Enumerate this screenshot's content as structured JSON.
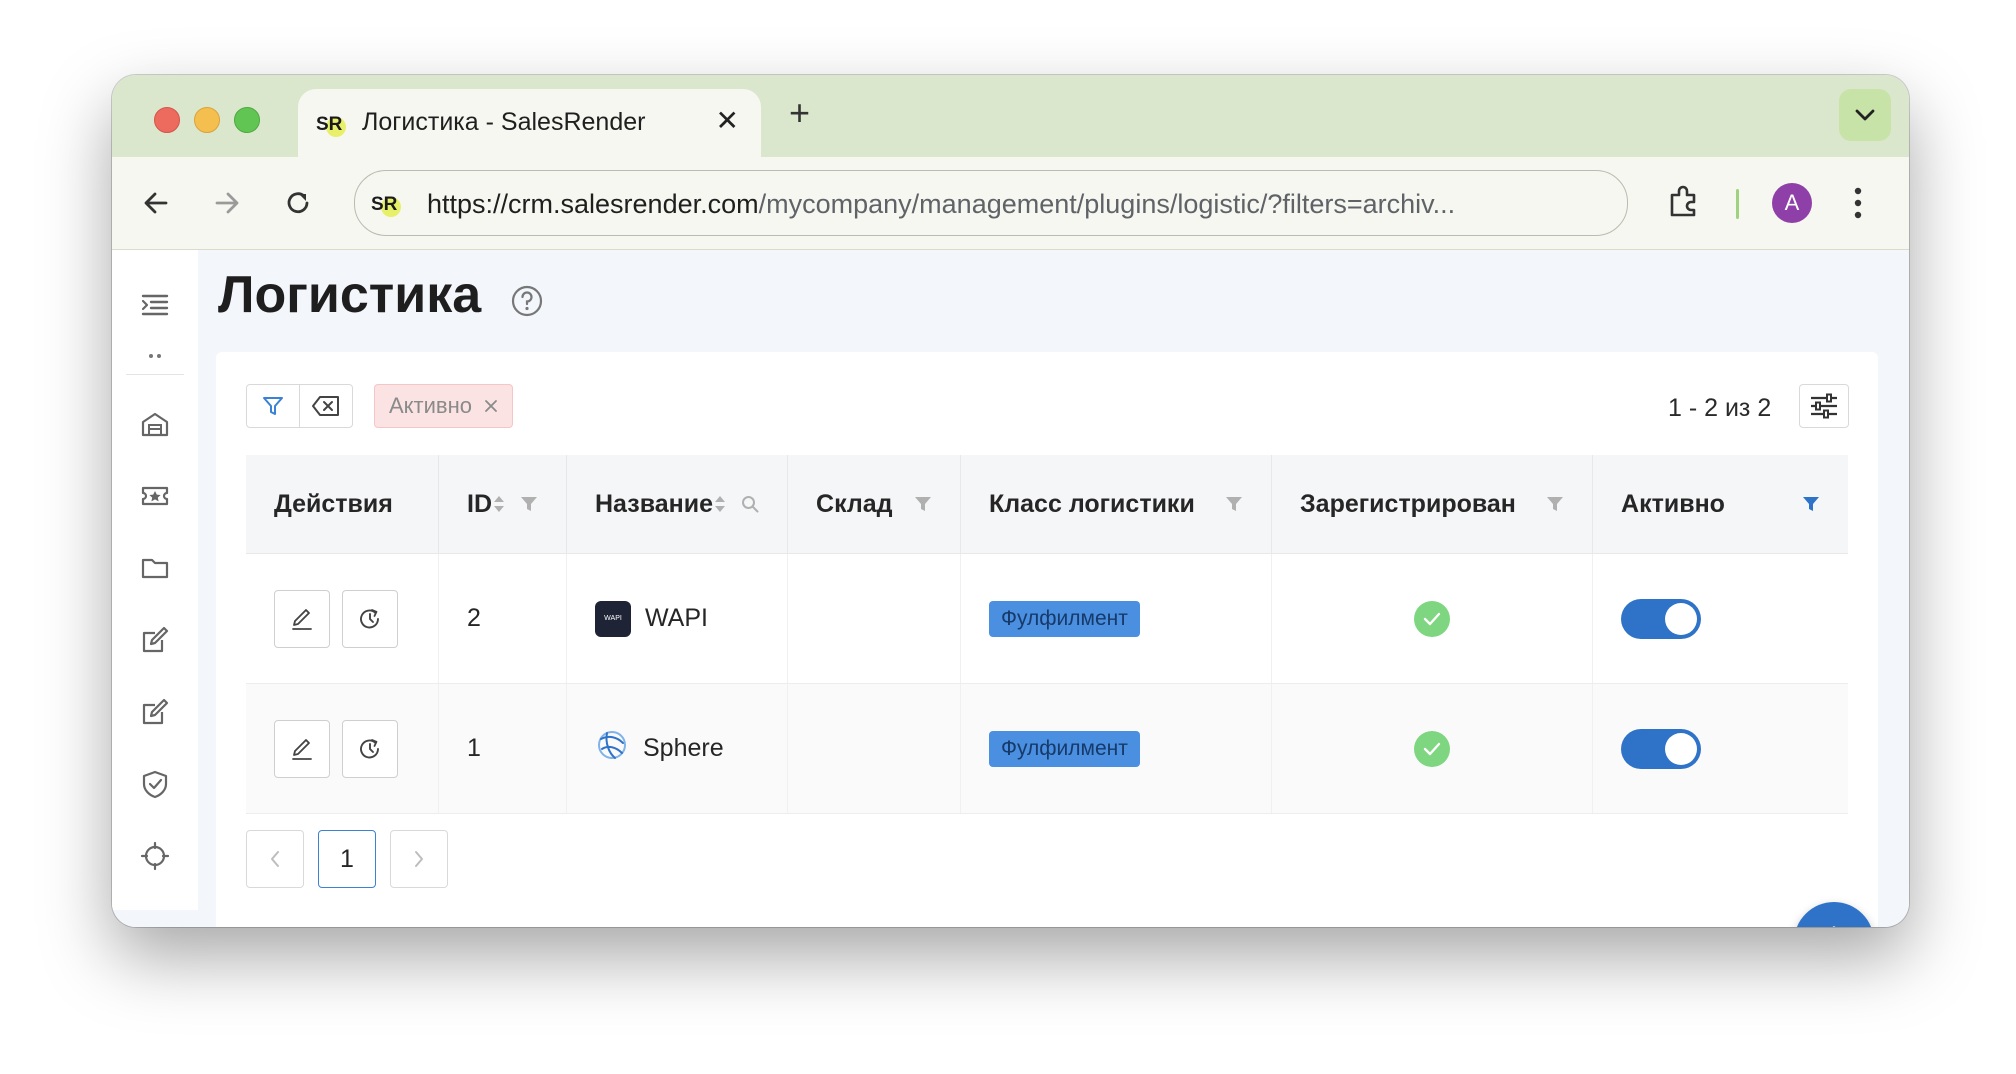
{
  "browser": {
    "tab_title": "Логистика - SalesRender",
    "favicon_text": "SR",
    "url_host": "https://crm.salesrender.com",
    "url_path": "/mycompany/management/plugins/logistic/?filters=archiv...",
    "avatar_letter": "A"
  },
  "page": {
    "title": "Логистика",
    "active_filter_chip": "Активно",
    "pager_info": "1 - 2 из 2"
  },
  "table": {
    "columns": [
      "Действия",
      "ID",
      "Название",
      "Склад",
      "Класс логистики",
      "Зарегистрирован",
      "Активно"
    ],
    "rows": [
      {
        "id": "2",
        "name": "WAPI",
        "logo_text": "WAPI",
        "warehouse": "",
        "class": "Фулфилмент",
        "registered": true,
        "active": true
      },
      {
        "id": "1",
        "name": "Sphere",
        "warehouse": "",
        "class": "Фулфилмент",
        "registered": true,
        "active": true
      }
    ]
  },
  "pagination": {
    "current": "1"
  },
  "colors": {
    "accent": "#2f73c9",
    "tag": "#4a8fe0",
    "check": "#7ed680",
    "chip_bg": "#fbe3e3",
    "tabbar": "#dbe7cd"
  }
}
